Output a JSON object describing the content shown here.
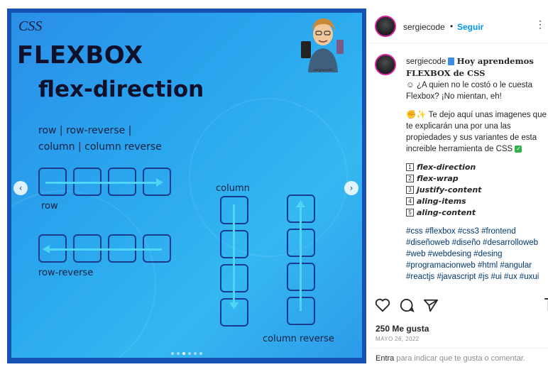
{
  "slide": {
    "css_tag": "CSS",
    "title": "FLEXBOX",
    "subtitle": "flex-direction",
    "options_line1": "row | row-reverse |",
    "options_line2": "column | column reverse",
    "label_row": "row",
    "label_row_reverse": "row-reverse",
    "label_column": "column",
    "label_column_reverse": "column reverse",
    "prev_icon": "chevron-left-icon",
    "next_icon": "chevron-right-icon",
    "page_count": 6,
    "active_page": 2
  },
  "header": {
    "username": "sergiecode",
    "separator": "•",
    "follow_label": "Seguir",
    "more_icon": "more-icon"
  },
  "caption": {
    "username": "sergiecode",
    "title": "Hoy aprendemos FLEXBOX de CSS",
    "line1": "¿A quien no le costó o le cuesta Flexbox? ¡No mientan, eh!",
    "line2": "Te dejo aquí unas imagenes que te explicarán una por una las propiedades y sus variantes de esta increible herramienta de CSS",
    "items": [
      {
        "num": "1",
        "text": "flex-direction"
      },
      {
        "num": "2",
        "text": "flex-wrap"
      },
      {
        "num": "3",
        "text": "justify-content"
      },
      {
        "num": "4",
        "text": "aling-items"
      },
      {
        "num": "5",
        "text": "aling-content"
      }
    ],
    "hashtags": "#css #flexbox #css3 #frontend #diseñoweb #diseño #desarrolloweb #web #webdesing #desing #programacionweb #html #angular #reactjs #javascript #js #ui #ux #uxui"
  },
  "actions": {
    "like_icon": "heart-icon",
    "comment_icon": "comment-icon",
    "share_icon": "share-icon",
    "save_icon": "bookmark-icon"
  },
  "likes": "250 Me gusta",
  "date": "MAYO 26, 2022",
  "footer": {
    "login_link": "Entra",
    "login_text": " para indicar que te gusta o comentar."
  }
}
